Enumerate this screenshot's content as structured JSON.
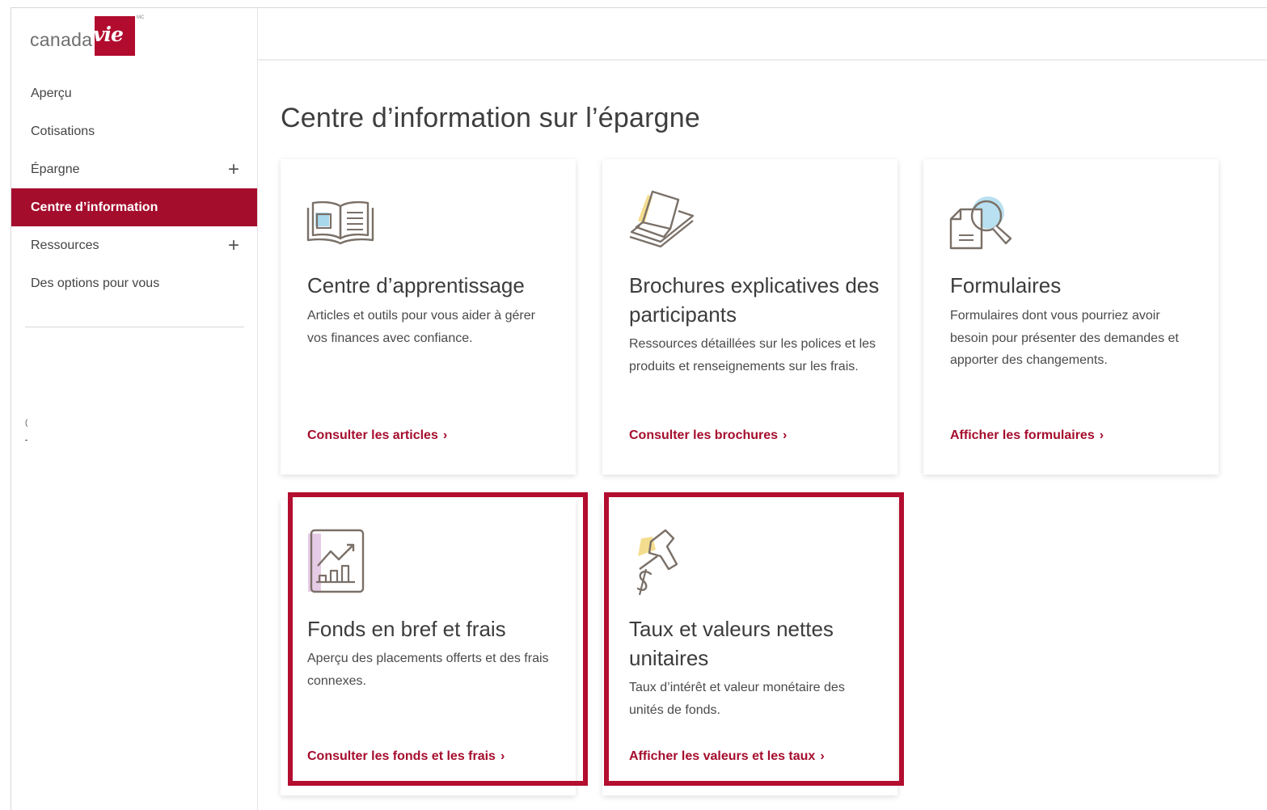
{
  "brand": {
    "logo_text": "canada",
    "logo_mark": "vie",
    "logo_tm": "MC",
    "accent": "#a50d2d"
  },
  "nav": {
    "items": [
      {
        "label": "Aperçu"
      },
      {
        "label": "Cotisations"
      },
      {
        "label": "Épargne",
        "expand": "+"
      },
      {
        "label": "Centre d’information",
        "active": true
      },
      {
        "label": "Ressources",
        "expand": "+"
      },
      {
        "label": "Des options pour vous"
      }
    ],
    "stray_char": "("
  },
  "page": {
    "title": "Centre d’information sur l’épargne"
  },
  "cards": [
    {
      "icon": "open-book-icon",
      "title": "Centre d’apprentissage",
      "desc": "Articles et outils pour vous aider à gérer vos finances avec confiance.",
      "link": "Consulter les articles"
    },
    {
      "icon": "brochures-stack-icon",
      "title": "Brochures explicatives des participants",
      "desc": "Ressources détaillées sur les polices et les produits et renseignements sur les frais.",
      "link": "Consulter les brochures"
    },
    {
      "icon": "form-magnifier-icon",
      "title": "Formulaires",
      "desc": "Formulaires dont vous pourriez avoir besoin pour présenter des demandes et apporter des changements.",
      "link": "Afficher les formulaires"
    },
    {
      "icon": "growth-chart-icon",
      "title": "Fonds en bref et frais",
      "desc": "Aperçu des placements offerts et des frais connexes.",
      "link": "Consulter les fonds et les frais"
    },
    {
      "icon": "pin-dollar-icon",
      "title": "Taux et valeurs nettes unitaires",
      "desc": "Taux d’intérêt et valeur monétaire des unités de fonds.",
      "link": "Afficher les valeurs et les taux"
    }
  ],
  "chevron": "›"
}
